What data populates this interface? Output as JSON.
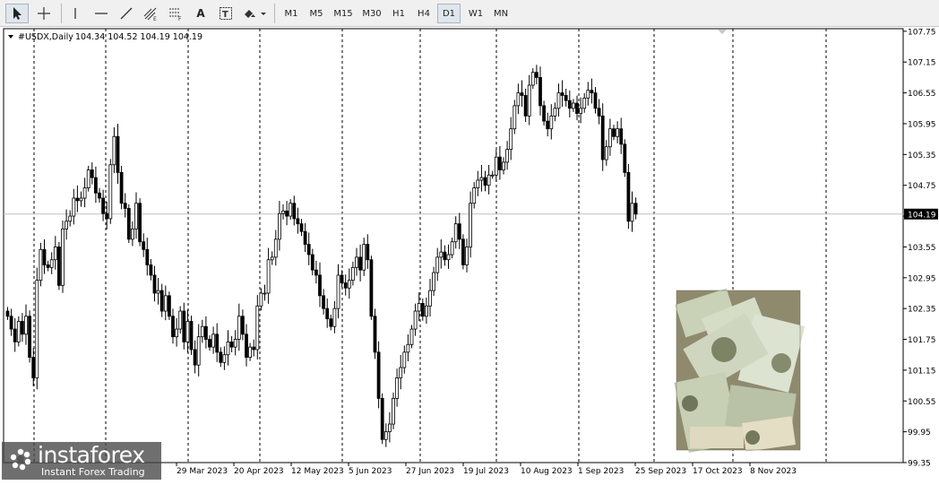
{
  "toolbar": {
    "tools": [
      {
        "name": "cursor-tool-button",
        "icon": "arrow-cursor-icon"
      },
      {
        "name": "crosshair-tool-button",
        "icon": "crosshair-icon"
      },
      {
        "name": "vertical-line-tool-button",
        "icon": "vertical-line-icon"
      },
      {
        "name": "horizontal-line-tool-button",
        "icon": "horizontal-line-icon"
      },
      {
        "name": "trendline-tool-button",
        "icon": "trendline-icon"
      },
      {
        "name": "equidistant-channel-button",
        "icon": "channel-icon"
      },
      {
        "name": "fibonacci-button",
        "icon": "fibonacci-icon"
      },
      {
        "name": "text-tool-button",
        "icon": "text-icon"
      },
      {
        "name": "text-label-tool-button",
        "icon": "text-label-icon"
      },
      {
        "name": "shapes-dropdown-button",
        "icon": "shapes-icon"
      }
    ],
    "timeframes": [
      "M1",
      "M5",
      "M15",
      "M30",
      "H1",
      "H4",
      "D1",
      "W1",
      "MN"
    ],
    "active_timeframe": "D1"
  },
  "chart_header": {
    "symbol": "#USDX,Daily",
    "ohlc": "104.34 104.52 104.19 104.19"
  },
  "watermark": {
    "brand": "instaforex",
    "tagline": "Instant Forex Trading"
  },
  "chart_data": {
    "type": "candlestick",
    "title": "#USDX,Daily",
    "ylim": [
      99.35,
      107.8
    ],
    "y_ticks": [
      "107.75",
      "107.15",
      "106.55",
      "105.95",
      "105.35",
      "104.75",
      "104.15",
      "103.55",
      "102.95",
      "102.35",
      "101.75",
      "101.15",
      "100.55",
      "99.95",
      "99.35"
    ],
    "x_tick_labels": [
      "29 Mar 2023",
      "20 Apr 2023",
      "12 May 2023",
      "5 Jun 2023",
      "27 Jun 2023",
      "19 Jul 2023",
      "10 Aug 2023",
      "1 Sep 2023",
      "25 Sep 2023",
      "17 Oct 2023",
      "8 Nov 2023"
    ],
    "current_price": "104.19",
    "colors": {
      "up": "#ffffff",
      "down": "#000000",
      "grid": "#000000",
      "bid_line": "#c0c0c0"
    },
    "close_series": [
      102.2,
      101.95,
      101.7,
      102.1,
      101.85,
      102.2,
      101.4,
      101.0,
      102.9,
      103.5,
      103.2,
      103.15,
      103.3,
      103.55,
      102.8,
      103.9,
      104.05,
      104.15,
      104.5,
      104.45,
      104.5,
      104.7,
      105.05,
      104.9,
      104.6,
      104.5,
      104.2,
      104.1,
      105.15,
      105.7,
      105.0,
      104.4,
      104.3,
      103.7,
      103.9,
      104.4,
      103.65,
      103.5,
      103.2,
      103.0,
      102.65,
      102.7,
      102.3,
      102.6,
      102.2,
      101.8,
      101.95,
      102.3,
      101.7,
      102.1,
      101.55,
      101.25,
      101.8,
      102.0,
      101.75,
      101.6,
      101.85,
      101.5,
      101.3,
      101.45,
      101.7,
      101.6,
      101.75,
      102.2,
      101.85,
      101.4,
      101.6,
      101.55,
      102.4,
      102.65,
      102.65,
      103.3,
      103.35,
      103.7,
      104.2,
      104.25,
      104.15,
      104.4,
      104.1,
      104.0,
      103.85,
      103.6,
      103.4,
      103.1,
      103.0,
      102.6,
      102.35,
      102.15,
      102.0,
      102.35,
      103.0,
      102.85,
      102.75,
      102.9,
      103.15,
      103.35,
      103.1,
      103.6,
      103.3,
      102.2,
      101.5,
      100.6,
      99.8,
      99.95,
      100.1,
      100.6,
      101.0,
      101.2,
      101.5,
      101.65,
      101.95,
      102.3,
      102.45,
      102.2,
      102.4,
      102.7,
      103.05,
      103.35,
      103.45,
      103.3,
      103.4,
      103.65,
      104.0,
      103.7,
      103.2,
      103.55,
      104.4,
      104.7,
      104.85,
      104.9,
      104.75,
      104.95,
      104.95,
      105.3,
      105.05,
      105.2,
      105.45,
      105.85,
      106.3,
      106.55,
      106.5,
      106.1,
      106.7,
      106.95,
      106.85,
      106.3,
      106.0,
      105.85,
      106.1,
      106.25,
      106.55,
      106.5,
      106.4,
      106.25,
      106.35,
      106.15,
      106.25,
      106.45,
      106.6,
      106.55,
      106.25,
      106.1,
      105.25,
      105.5,
      105.85,
      105.7,
      105.85,
      105.55,
      105.0,
      104.05,
      104.4,
      104.19
    ]
  }
}
